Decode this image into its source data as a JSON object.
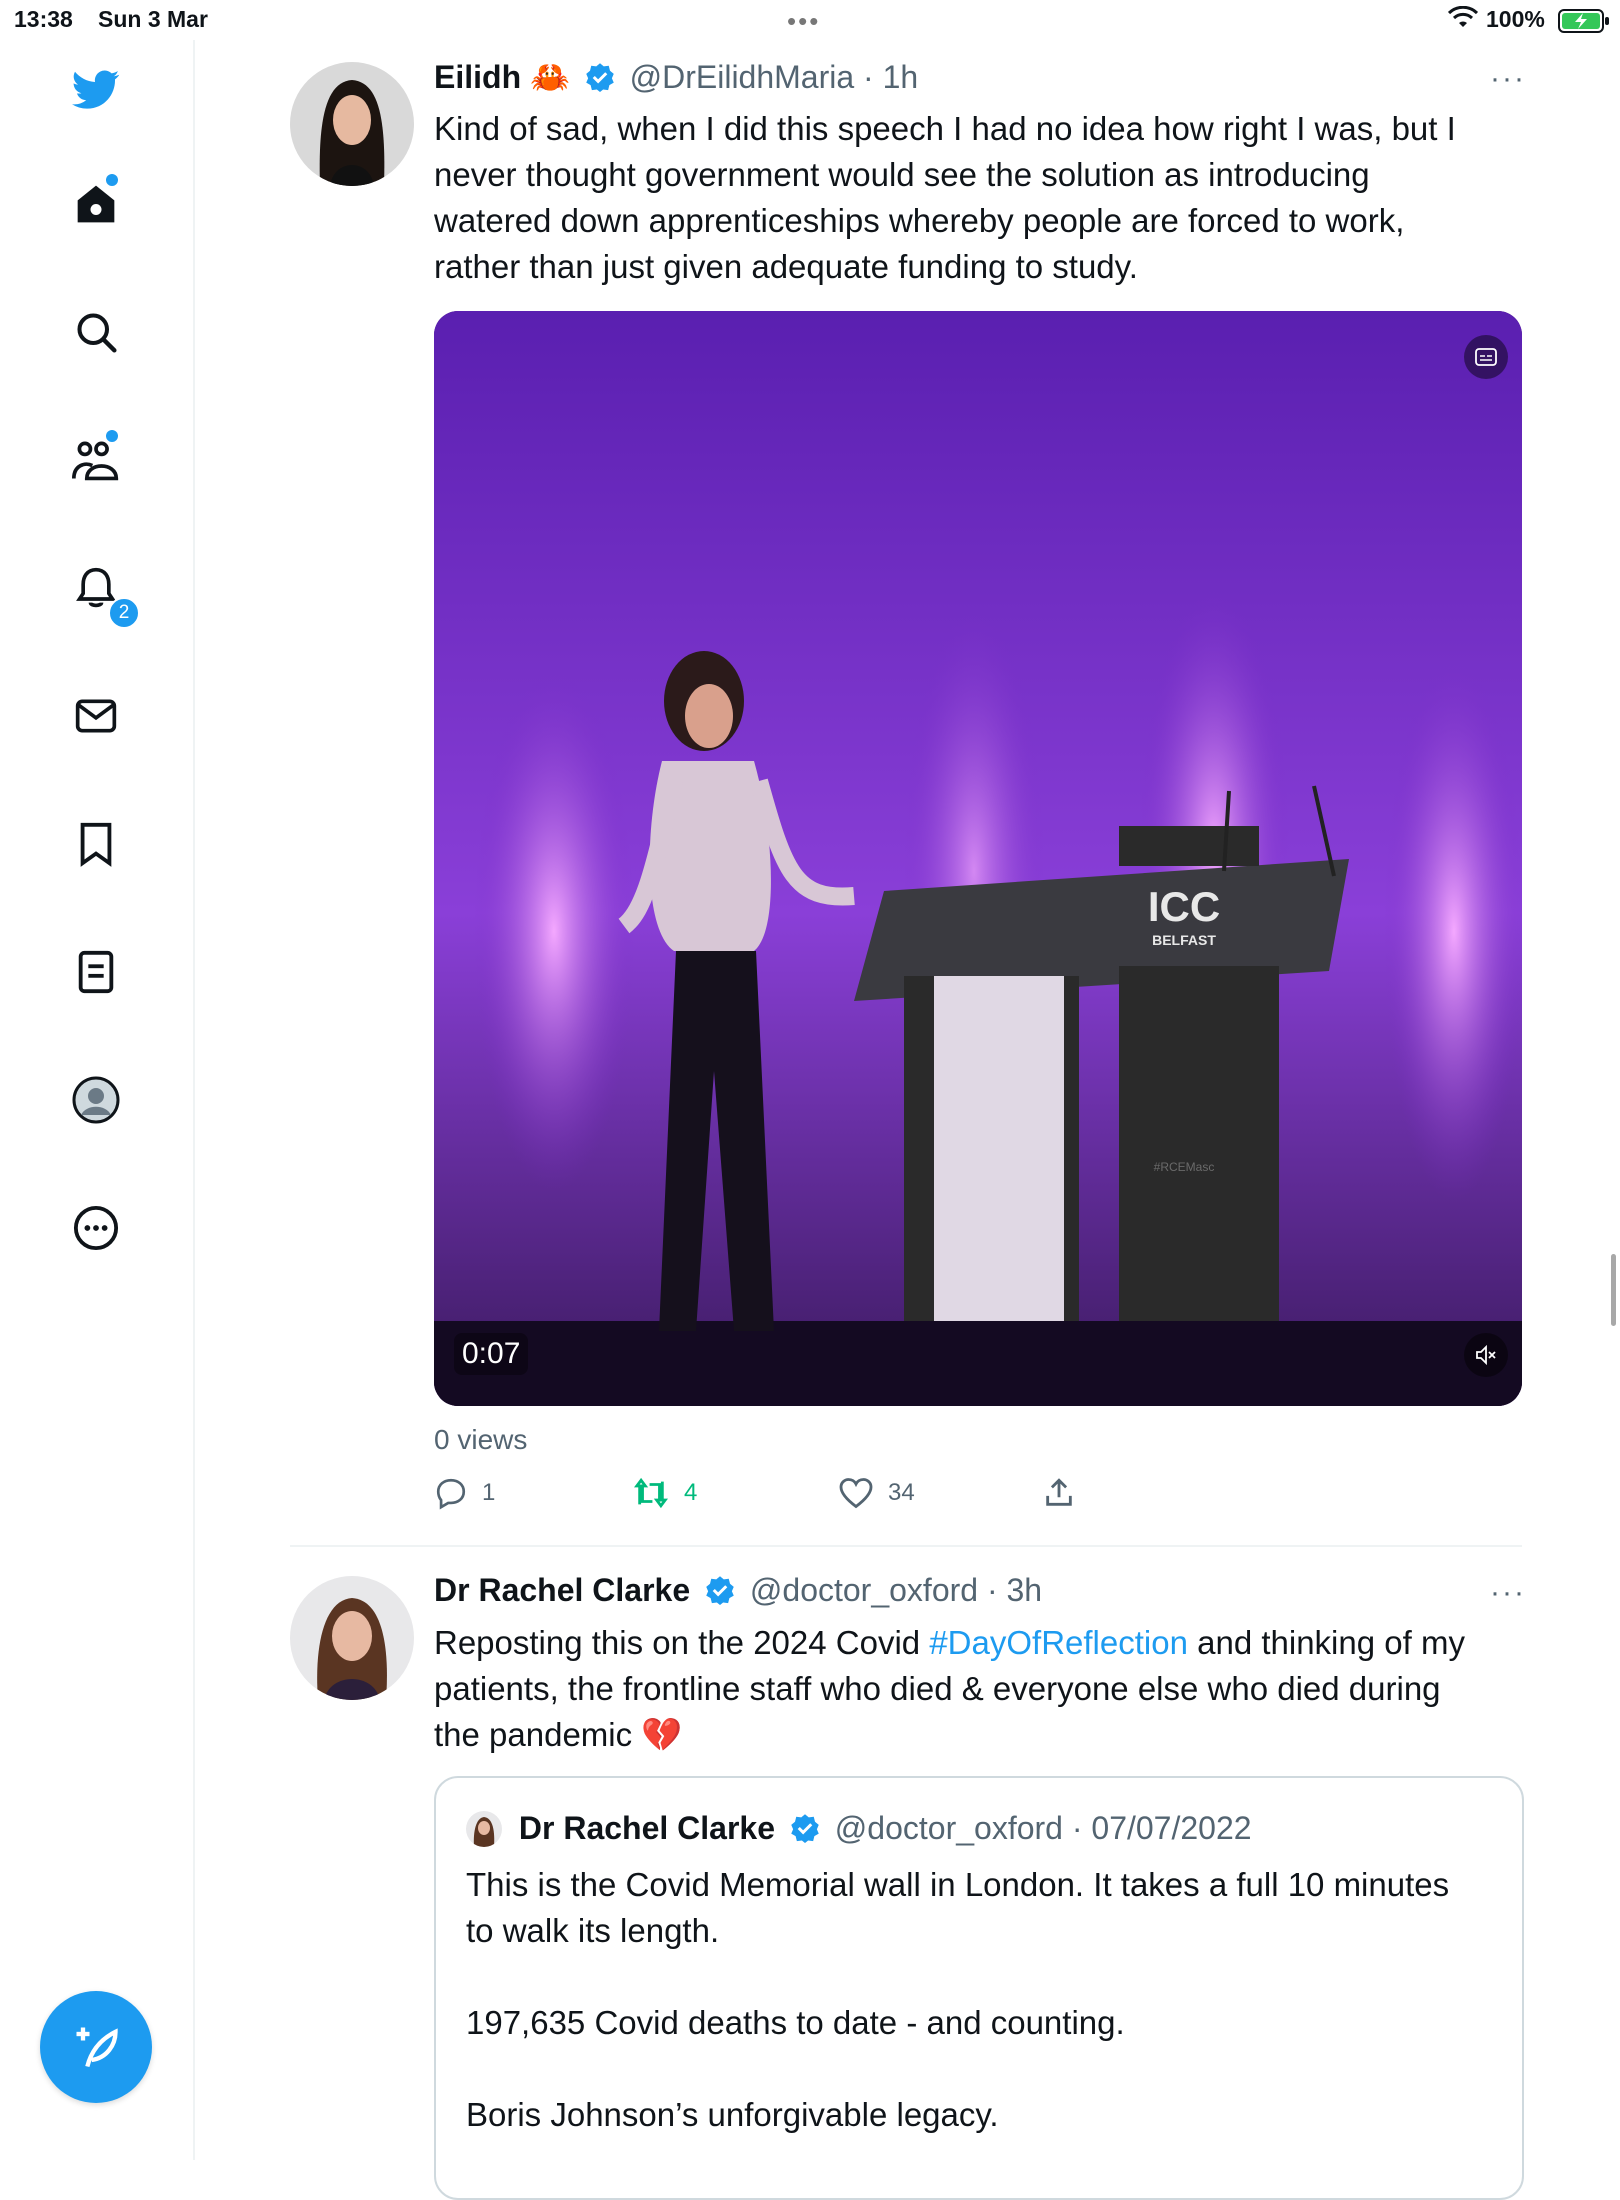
{
  "status_bar": {
    "time": "13:38",
    "date": "Sun 3 Mar",
    "battery": "100%"
  },
  "sidebar": {
    "items": [
      {
        "icon": "twitter-logo-icon"
      },
      {
        "icon": "home-icon"
      },
      {
        "icon": "search-icon"
      },
      {
        "icon": "communities-icon"
      },
      {
        "icon": "notifications-bell-icon",
        "badge": "2"
      },
      {
        "icon": "messages-mail-icon"
      },
      {
        "icon": "bookmark-icon"
      },
      {
        "icon": "lists-icon"
      },
      {
        "icon": "profile-icon"
      },
      {
        "icon": "more-circle-icon"
      }
    ],
    "compose_icon": "compose-feather-icon"
  },
  "tweets": [
    {
      "name": "Eilidh",
      "emoji": "🦀",
      "handle": "@DrEilidhMaria",
      "time": "· 1h",
      "text_lines": [
        "Kind of sad, when I did this speech I had no idea how right I was, but I",
        "never thought government would see the solution as introducing",
        "watered down apprenticeships whereby people are forced to work,",
        "rather than just given adequate funding to study."
      ],
      "video": {
        "duration": "0:07",
        "podium_text": "ICC",
        "podium_sub": "BELFAST",
        "podium_tag": "#RCEMasc"
      },
      "views": "0 views",
      "stats": {
        "replies": "1",
        "retweets": "4",
        "likes": "34"
      }
    },
    {
      "name": "Dr Rachel Clarke",
      "handle": "@doctor_oxford",
      "time": "· 3h",
      "line1_pre": "Reposting this on the 2024 Covid ",
      "line1_tag": "#DayOfReflection",
      "line1_post": " and thinking of my",
      "line2": "patients, the frontline staff who died & everyone else who died during",
      "line3": "the pandemic 💔",
      "quote": {
        "name": "Dr Rachel Clarke",
        "handle": "@doctor_oxford",
        "date": "· 07/07/2022",
        "lines": [
          "This is the Covid Memorial wall in London. It takes a full 10 minutes",
          "to walk its length.",
          "197,635 Covid deaths to date - and counting.",
          "Boris Johnson’s unforgivable legacy."
        ]
      }
    }
  ],
  "colors": {
    "accent": "#1d9bf0",
    "retweet": "#00ba7c",
    "muted": "#536471"
  }
}
